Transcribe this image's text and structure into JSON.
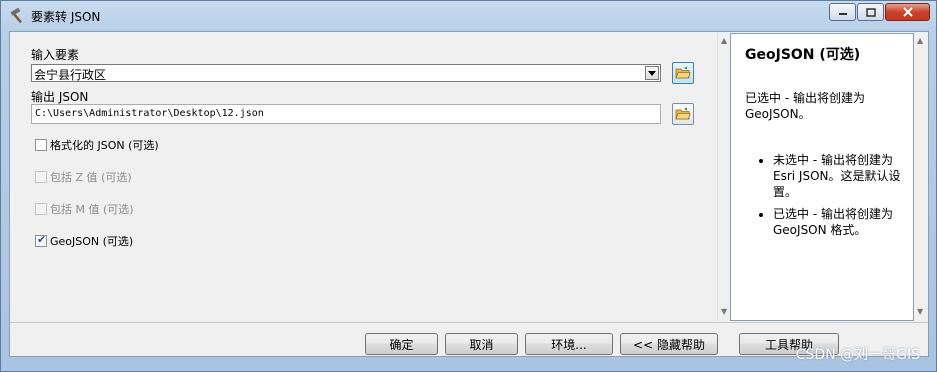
{
  "window": {
    "title": "要素转 JSON",
    "icon": "hammer-icon",
    "controls": [
      "minimize-icon",
      "maximize-icon",
      "close-icon"
    ]
  },
  "form": {
    "input_label": "输入要素",
    "input_value": "会宁县行政区",
    "output_label": "输出 JSON",
    "output_value": "C:\\Users\\Administrator\\Desktop\\12.json",
    "checkboxes": [
      {
        "label": "格式化的 JSON (可选)",
        "checked": false,
        "enabled": true
      },
      {
        "label": "包括 Z 值 (可选)",
        "checked": false,
        "enabled": false
      },
      {
        "label": "包括 M 值 (可选)",
        "checked": false,
        "enabled": false
      },
      {
        "label": "GeoJSON (可选)",
        "checked": true,
        "enabled": true
      }
    ]
  },
  "help": {
    "title": "GeoJSON (可选)",
    "intro": "已选中 - 输出将创建为 GeoJSON。",
    "bullets": [
      "未选中 - 输出将创建为 Esri JSON。这是默认设置。",
      "已选中 - 输出将创建为 GeoJSON 格式。"
    ]
  },
  "buttons": {
    "ok": "确定",
    "cancel": "取消",
    "env": "环境...",
    "hide_help": "<< 隐藏帮助",
    "tool_help": "工具帮助"
  },
  "watermark": "CSDN @刘一哥GIS"
}
